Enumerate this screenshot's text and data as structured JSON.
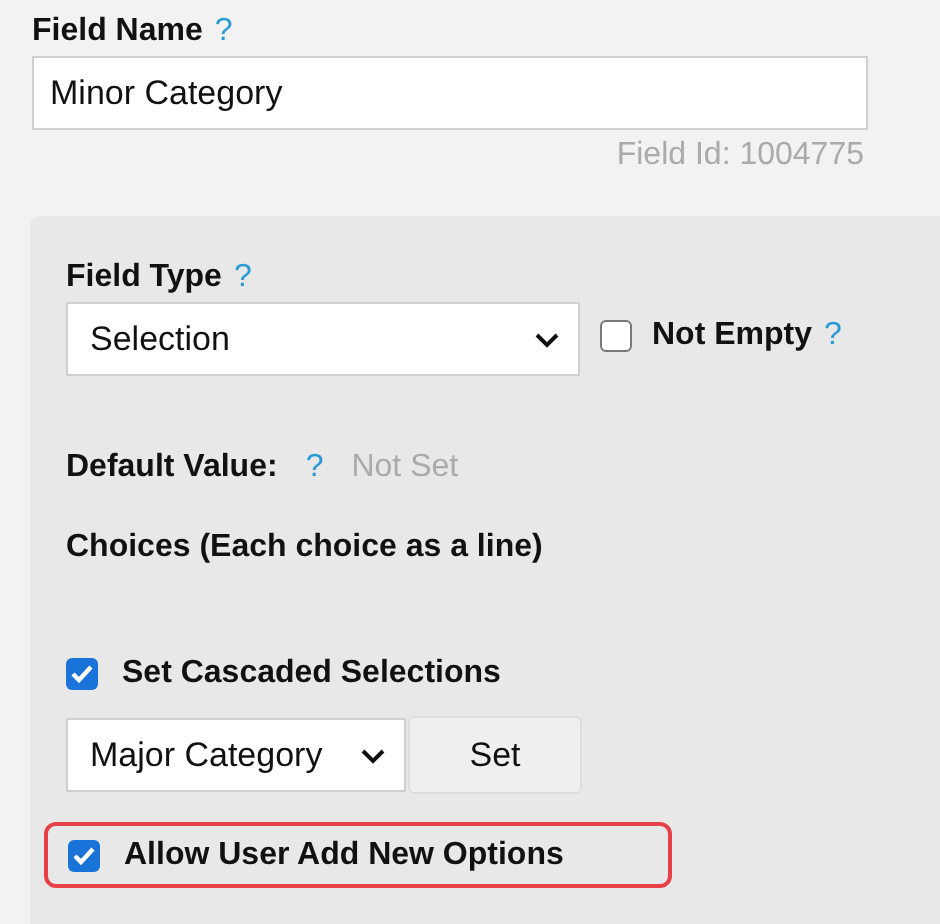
{
  "field_name": {
    "label": "Field Name",
    "help": "?",
    "value": "Minor Category",
    "field_id": "Field Id: 1004775"
  },
  "field_type": {
    "label": "Field Type",
    "help": "?",
    "value": "Selection"
  },
  "not_empty": {
    "label": "Not Empty",
    "checked": false,
    "help": "?"
  },
  "default_value": {
    "label": "Default Value:",
    "help": "?",
    "value": "Not Set"
  },
  "choices": {
    "label": "Choices (Each choice as a line)"
  },
  "cascade": {
    "label": "Set Cascaded Selections",
    "checked": true,
    "select_value": "Major Category",
    "button": "Set"
  },
  "allow_new_options": {
    "label": "Allow User Add New Options",
    "checked": true,
    "highlighted": true
  }
}
